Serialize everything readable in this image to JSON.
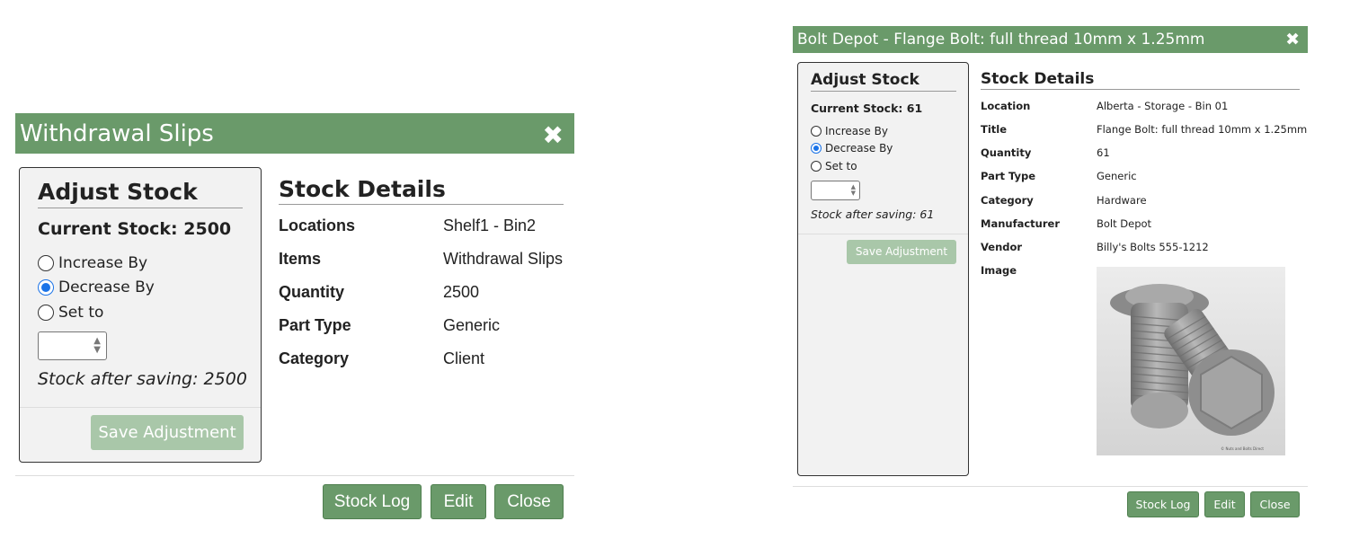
{
  "dialog1": {
    "title": "Withdrawal Slips",
    "close_glyph": "✖",
    "adjust": {
      "heading": "Adjust Stock",
      "current_stock": "Current Stock: 2500",
      "options": [
        {
          "label": "Increase By",
          "checked": false
        },
        {
          "label": "Decrease By",
          "checked": true
        },
        {
          "label": "Set to",
          "checked": false
        }
      ],
      "stepper_value": "",
      "stock_after": "Stock after saving: 2500",
      "save_label": "Save Adjustment"
    },
    "details": {
      "heading": "Stock Details",
      "rows": [
        {
          "k": "Locations",
          "v": "Shelf1 - Bin2"
        },
        {
          "k": "Items",
          "v": "Withdrawal Slips"
        },
        {
          "k": "Quantity",
          "v": "2500"
        },
        {
          "k": "Part Type",
          "v": "Generic"
        },
        {
          "k": "Category",
          "v": "Client"
        }
      ]
    },
    "buttons": {
      "stock_log": "Stock Log",
      "edit": "Edit",
      "close": "Close"
    }
  },
  "dialog2": {
    "title": "Bolt Depot - Flange Bolt: full thread 10mm x 1.25mm",
    "close_glyph": "✖",
    "adjust": {
      "heading": "Adjust Stock",
      "current_stock": "Current Stock: 61",
      "options": [
        {
          "label": "Increase By",
          "checked": false
        },
        {
          "label": "Decrease By",
          "checked": true
        },
        {
          "label": "Set to",
          "checked": false
        }
      ],
      "stepper_value": "",
      "stock_after": "Stock after saving: 61",
      "save_label": "Save Adjustment"
    },
    "details": {
      "heading": "Stock Details",
      "rows": [
        {
          "k": "Location",
          "v": "Alberta - Storage - Bin 01"
        },
        {
          "k": "Title",
          "v": "Flange Bolt: full thread 10mm x 1.25mm"
        },
        {
          "k": "Quantity",
          "v": "61"
        },
        {
          "k": "Part Type",
          "v": "Generic"
        },
        {
          "k": "Category",
          "v": "Hardware"
        },
        {
          "k": "Manufacturer",
          "v": "Bolt Depot"
        },
        {
          "k": "Vendor",
          "v": "Billy's Bolts 555-1212"
        },
        {
          "k": "Image",
          "v": ""
        }
      ],
      "image_label": "bolt-image"
    },
    "buttons": {
      "stock_log": "Stock Log",
      "edit": "Edit",
      "close": "Close"
    }
  },
  "colors": {
    "titlebar": "#6a9a6a",
    "button": "#6a9a6a",
    "save_disabled": "#a9c7a9",
    "radio_checked": "#1a73e8"
  },
  "icons": {
    "close": "close-icon",
    "stepper": "spin-arrows-icon"
  }
}
